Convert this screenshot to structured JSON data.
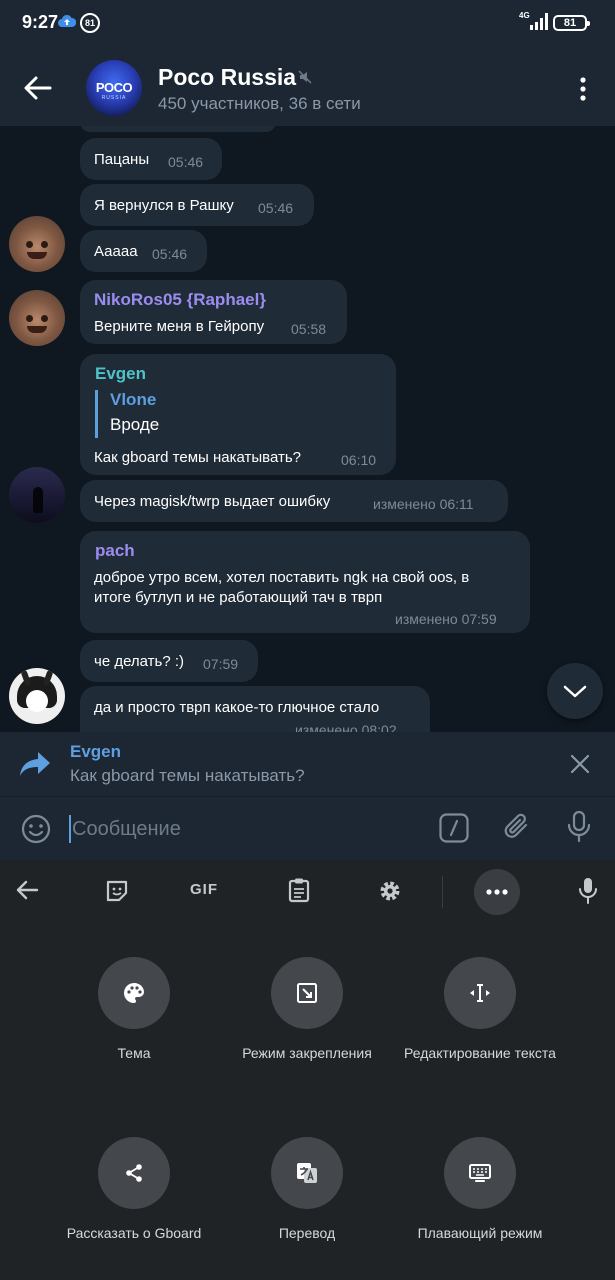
{
  "status_bar": {
    "time": "9:27",
    "notification_count": "81",
    "network": "4G",
    "battery": "81"
  },
  "header": {
    "title": "Poco Russia",
    "subtitle": "450 участников, 36 в сети",
    "avatar_text": "POCO",
    "avatar_subtext": "RUSSIA"
  },
  "messages": [
    {
      "text": "Пацаны",
      "time": "05:46"
    },
    {
      "text": "Я вернулся в Рашку",
      "time": "05:46"
    },
    {
      "text": "Ааааа",
      "time": "05:46"
    },
    {
      "sender": "NikoRos05 {Raphael}",
      "text": "Верните меня в Гейропу",
      "time": "05:58"
    },
    {
      "sender": "Evgen",
      "quote_sender": "Vlone",
      "quote_text": "Вроде",
      "text": "Как gboard темы накатывать?",
      "time": "06:10"
    },
    {
      "text": "Через magisk/twrp выдает ошибку",
      "time": "изменено 06:11"
    },
    {
      "sender": "pach",
      "text_line1": "доброе утро всем, хотел поставить ngk на свой oos, в",
      "text_line2": "итоге бутлуп и не работающий тач в тврп",
      "time": "изменено 07:59"
    },
    {
      "text": "че делать? :)",
      "time": "07:59"
    },
    {
      "text": "да и просто твpп какое-то глючное стало",
      "time": "изменено 08:02"
    }
  ],
  "reply": {
    "name": "Evgen",
    "text": "Как gboard темы накатывать?"
  },
  "input": {
    "placeholder": "Сообщение",
    "value": ""
  },
  "keyboard": {
    "toolbar": {
      "gif_label": "GIF"
    },
    "tiles": [
      {
        "icon": "palette-icon",
        "label": "Тема"
      },
      {
        "icon": "one-handed-mode-icon",
        "label": "Режим закрепления"
      },
      {
        "icon": "text-editing-icon",
        "label": "Редактирование текста"
      },
      {
        "icon": "share-icon",
        "label": "Рассказать о Gboard"
      },
      {
        "icon": "translate-icon",
        "label": "Перевод"
      },
      {
        "icon": "floating-keyboard-icon",
        "label": "Плавающий режим"
      }
    ]
  },
  "colors": {
    "background": "#0f1720",
    "header": "#1d2733",
    "bubble": "#1f2b37",
    "accent": "#5e9fe0",
    "keyboard": "#202326"
  }
}
